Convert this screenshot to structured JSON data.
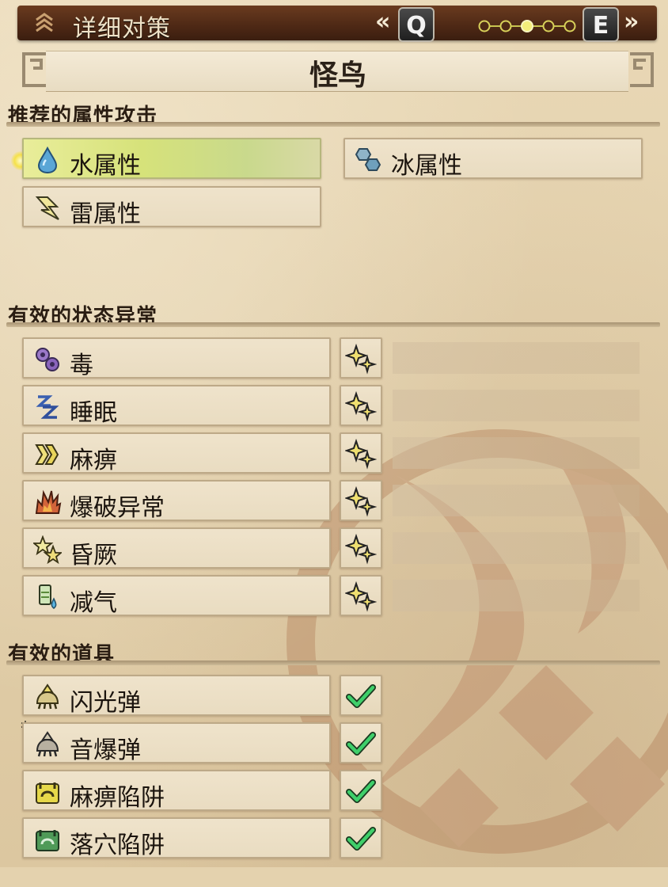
{
  "header": {
    "title": "详细对策",
    "prev_key": "Q",
    "next_key": "E",
    "prev_chevron": "«",
    "next_chevron": "»",
    "page_dots": {
      "total": 5,
      "active_index": 2
    }
  },
  "monster": {
    "name": "怪鸟"
  },
  "sections": {
    "elements": {
      "title": "推荐的属性攻击"
    },
    "ailments": {
      "title": "有效的状态异常"
    },
    "items": {
      "title": "有效的道具"
    }
  },
  "elements": [
    {
      "label": "水属性",
      "icon": "water-drop-icon",
      "selected": true
    },
    {
      "label": "冰属性",
      "icon": "ice-crystal-icon",
      "selected": false
    },
    {
      "label": "雷属性",
      "icon": "thunder-bolt-icon",
      "selected": false
    }
  ],
  "ailments": [
    {
      "label": "毒",
      "icon": "poison-icon",
      "effect_icon": "sparkle-icon"
    },
    {
      "label": "睡眠",
      "icon": "sleep-icon",
      "effect_icon": "sparkle-icon"
    },
    {
      "label": "麻痹",
      "icon": "paralysis-icon",
      "effect_icon": "sparkle-icon"
    },
    {
      "label": "爆破异常",
      "icon": "blast-icon",
      "effect_icon": "sparkle-icon"
    },
    {
      "label": "昏厥",
      "icon": "stun-icon",
      "effect_icon": "sparkle-icon"
    },
    {
      "label": "减气",
      "icon": "exhaust-icon",
      "effect_icon": "sparkle-icon"
    }
  ],
  "items": [
    {
      "label": "闪光弹",
      "icon": "flash-pod-icon",
      "effective": true,
      "marker": ""
    },
    {
      "label": "音爆弹",
      "icon": "screamer-pod-icon",
      "effective": true,
      "marker": "*"
    },
    {
      "label": "麻痹陷阱",
      "icon": "shock-trap-icon",
      "effective": true,
      "marker": ""
    },
    {
      "label": "落穴陷阱",
      "icon": "pitfall-trap-icon",
      "effective": true,
      "marker": ""
    }
  ],
  "colors": {
    "header_bg": "#4d2815",
    "parchment": "#e4d2ae",
    "highlight": "#d6e27a",
    "check_green": "#3fcf6a",
    "sparkle_yellow": "#f0e070"
  }
}
